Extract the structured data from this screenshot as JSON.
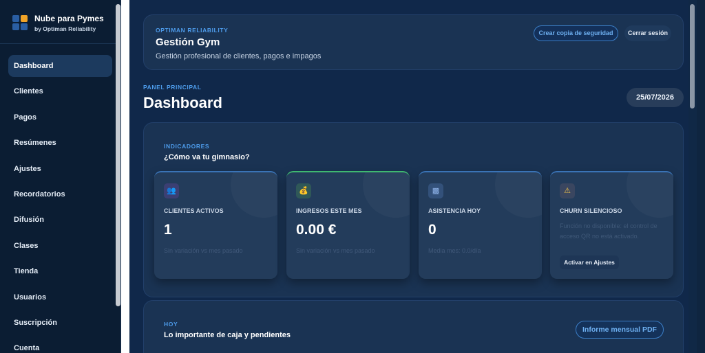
{
  "brand": {
    "title": "Nube para Pymes",
    "subtitle": "by Optiman Reliability"
  },
  "sidebar": {
    "items": [
      {
        "label": "Dashboard",
        "active": true
      },
      {
        "label": "Clientes"
      },
      {
        "label": "Pagos"
      },
      {
        "label": "Resúmenes"
      },
      {
        "label": "Ajustes"
      },
      {
        "label": "Recordatorios"
      },
      {
        "label": "Difusión"
      },
      {
        "label": "Clases"
      },
      {
        "label": "Tienda"
      },
      {
        "label": "Usuarios"
      },
      {
        "label": "Suscripción"
      },
      {
        "label": "Cuenta"
      }
    ]
  },
  "header": {
    "eyebrow": "OPTIMAN RELIABILITY",
    "title": "Gestión Gym",
    "subtitle": "Gestión profesional de clientes, pagos e impagos",
    "backup_label": "Crear copia de seguridad",
    "logout_label": "Cerrar sesión"
  },
  "page": {
    "eyebrow": "PANEL PRINCIPAL",
    "title": "Dashboard",
    "date": "25/07/2026"
  },
  "indicators": {
    "eyebrow": "INDICADORES",
    "heading": "¿Cómo va tu gimnasio?",
    "cards": [
      {
        "icon": "users-icon",
        "label": "CLIENTES ACTIVOS",
        "value": "1",
        "note": "Sin variación vs mes pasado"
      },
      {
        "icon": "money-bag-icon",
        "label": "INGRESOS ESTE MES",
        "value": "0.00 €",
        "note": "Sin variación vs mes pasado"
      },
      {
        "icon": "bar-chart-icon",
        "label": "ASISTENCIA HOY",
        "value": "0",
        "note": "Media mes: 0.0/día"
      },
      {
        "icon": "warning-icon",
        "label": "CHURN SILENCIOSO",
        "description": "Función no disponible: el control de acceso QR no está activado.",
        "action": "Activar en Ajustes"
      }
    ]
  },
  "today": {
    "eyebrow": "HOY",
    "heading": "Lo importante de caja y pendientes",
    "report_label": "Informe mensual PDF"
  },
  "colors": {
    "accent": "#4d9bea",
    "card_border_blue": "#3a73b6",
    "card_border_green": "#3fb870"
  }
}
